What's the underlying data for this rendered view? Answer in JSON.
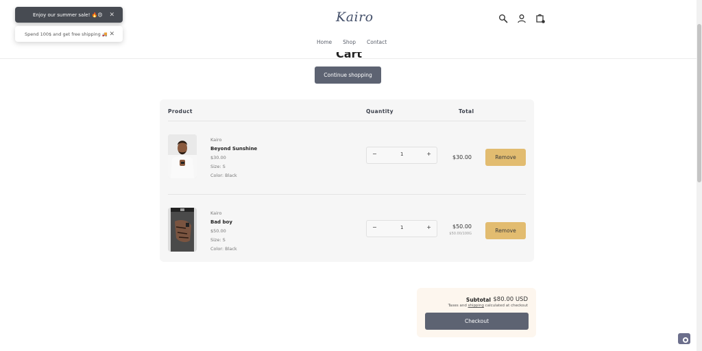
{
  "header": {
    "logo": "Kairo",
    "nav": [
      "Home",
      "Shop",
      "Contact"
    ],
    "icons": [
      "search-icon",
      "account-icon",
      "cart-icon"
    ]
  },
  "toasts": [
    {
      "text": "Enjoy our summer sale! 🔥😍"
    },
    {
      "text": "Spend 100$ and get free shipping 🚚"
    }
  ],
  "cart": {
    "title": "Cart",
    "continue_label": "Continue shopping",
    "columns": {
      "product": "Product",
      "quantity": "Quantity",
      "total": "Total"
    },
    "items": [
      {
        "vendor": "Kairo",
        "name": "Beyond Sunshine",
        "price": "$30.00",
        "size": "Size: S",
        "color": "Color: Black",
        "qty": "1",
        "total": "$30.00",
        "original": "",
        "remove_label": "Remove"
      },
      {
        "vendor": "Kairo",
        "name": "Bad boy",
        "price": "$50.00",
        "size": "Size: S",
        "color": "Color: Black",
        "qty": "1",
        "total": "$50.00",
        "original": "$50.00/100G",
        "remove_label": "Remove"
      }
    ]
  },
  "summary": {
    "subtotal_label": "Subtotal",
    "subtotal_value": "$80.00 USD",
    "tax_prefix": "Taxes and ",
    "tax_link": "shipping",
    "tax_suffix": " calculated at checkout",
    "checkout_label": "Checkout"
  },
  "colors": {
    "primary_button": "#5d6372",
    "remove_button": "#e2bc70",
    "summary_bg": "#fdf6ee",
    "panel_bg": "#f6f6f6"
  }
}
